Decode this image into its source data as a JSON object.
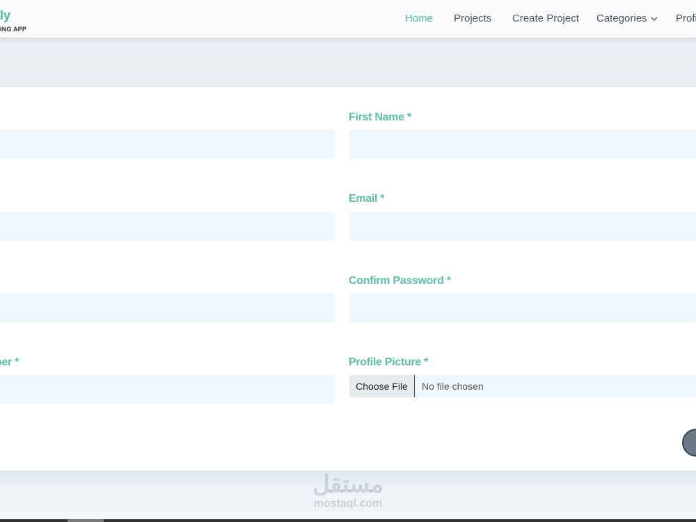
{
  "brand": {
    "name": "ly",
    "tagline": "ING APP"
  },
  "nav": {
    "items": [
      {
        "label": "Home",
        "active": true
      },
      {
        "label": "Projects",
        "active": false
      },
      {
        "label": "Create Project",
        "active": false
      },
      {
        "label": "Categories",
        "active": false,
        "dropdown": true
      },
      {
        "label": "Profi",
        "active": false
      }
    ]
  },
  "form": {
    "left_labels": [
      "",
      "",
      "",
      "ber *"
    ],
    "right_labels": [
      "First Name *",
      "Email *",
      "Confirm Password *",
      "Profile Picture *"
    ],
    "file": {
      "button": "Choose File",
      "status": "No file chosen"
    }
  },
  "watermark": {
    "arabic": "مستقل",
    "latin": "mostaql.com"
  },
  "colors": {
    "accent": "#5cbfa6",
    "input_bg": "#eef6fe",
    "card_bg": "#ffffff"
  }
}
